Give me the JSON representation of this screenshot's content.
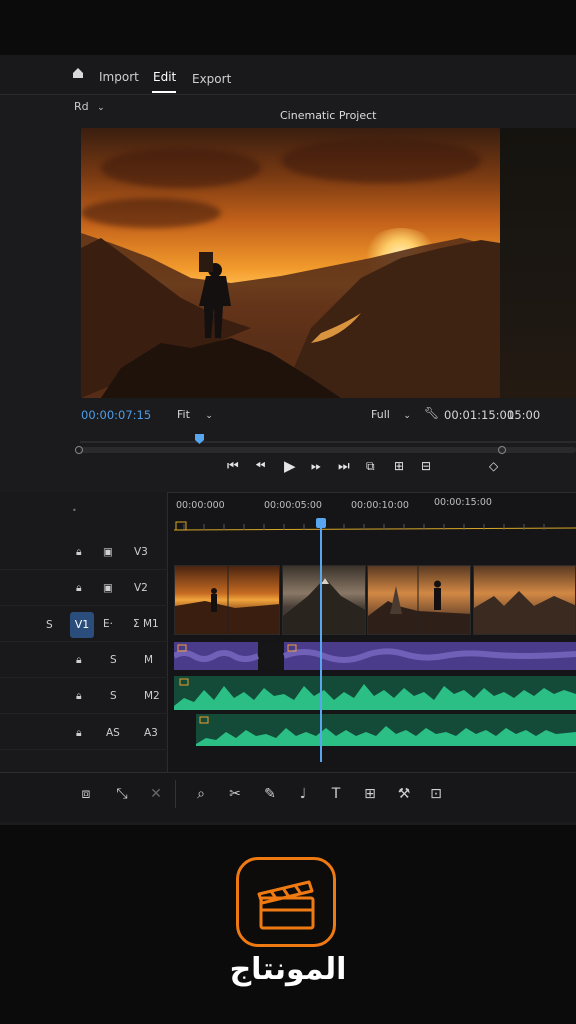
{
  "menu": {
    "import": "Import",
    "edit": "Edit",
    "export": "Export"
  },
  "toolbar": {
    "zoom_label": "Rd"
  },
  "project_title": "Cinematic Project",
  "viewer": {
    "current_timecode": "00:00:07:15",
    "fit_select": "Fit",
    "quality_select": "Full",
    "duration": "00:01:15:00",
    "end_time": "15:00"
  },
  "timeline": {
    "ruler_labels": [
      "00:00:000",
      "00:00:05:00",
      "00:00:10:00",
      "00:00:15:00"
    ],
    "tracks": [
      {
        "name": "V3",
        "icons": [
          "lock-icon",
          "camera-icon"
        ]
      },
      {
        "name": "V2",
        "icons": [
          "lock-icon",
          "camera-icon"
        ]
      },
      {
        "name": "V1",
        "solo": "S",
        "extra": "E·",
        "extra2": "Σ M1"
      },
      {
        "name": "M",
        "sub": "S"
      },
      {
        "name": "M2",
        "sub": "S"
      },
      {
        "name": "A3",
        "sub": "AS"
      }
    ]
  },
  "app": {
    "name": "المونتاج"
  },
  "colors": {
    "accent": "#f07a12",
    "playhead": "#58a6f0",
    "audio_green": "#2bbf86",
    "audio_purple": "#6e56b8"
  }
}
